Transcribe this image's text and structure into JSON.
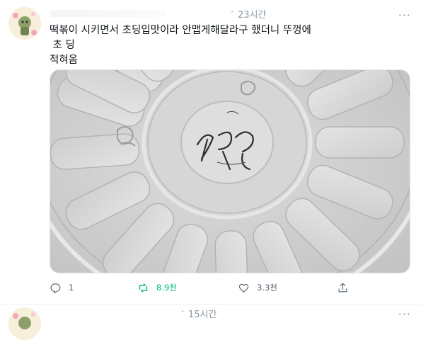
{
  "tweet": {
    "time_sep": "·",
    "time": "23시간",
    "more_label": "···",
    "text_lines": [
      "떡볶이 시키면서 초딩입맛이라 안맵게해달라구 했더니 뚜껑에",
      " 초 딩",
      "적혀옴"
    ],
    "actions": {
      "reply_count": "1",
      "retweet_count": "8.9천",
      "like_count": "3.3천"
    },
    "icons": {
      "reply": "reply-icon",
      "retweet": "retweet-icon",
      "like": "heart-icon",
      "share": "share-icon"
    },
    "colors": {
      "retweet_active": "#00ba7c",
      "secondary_text": "#536471"
    }
  },
  "next_tweet": {
    "time_sep": "·",
    "time": "15시간",
    "more_label": "···"
  }
}
